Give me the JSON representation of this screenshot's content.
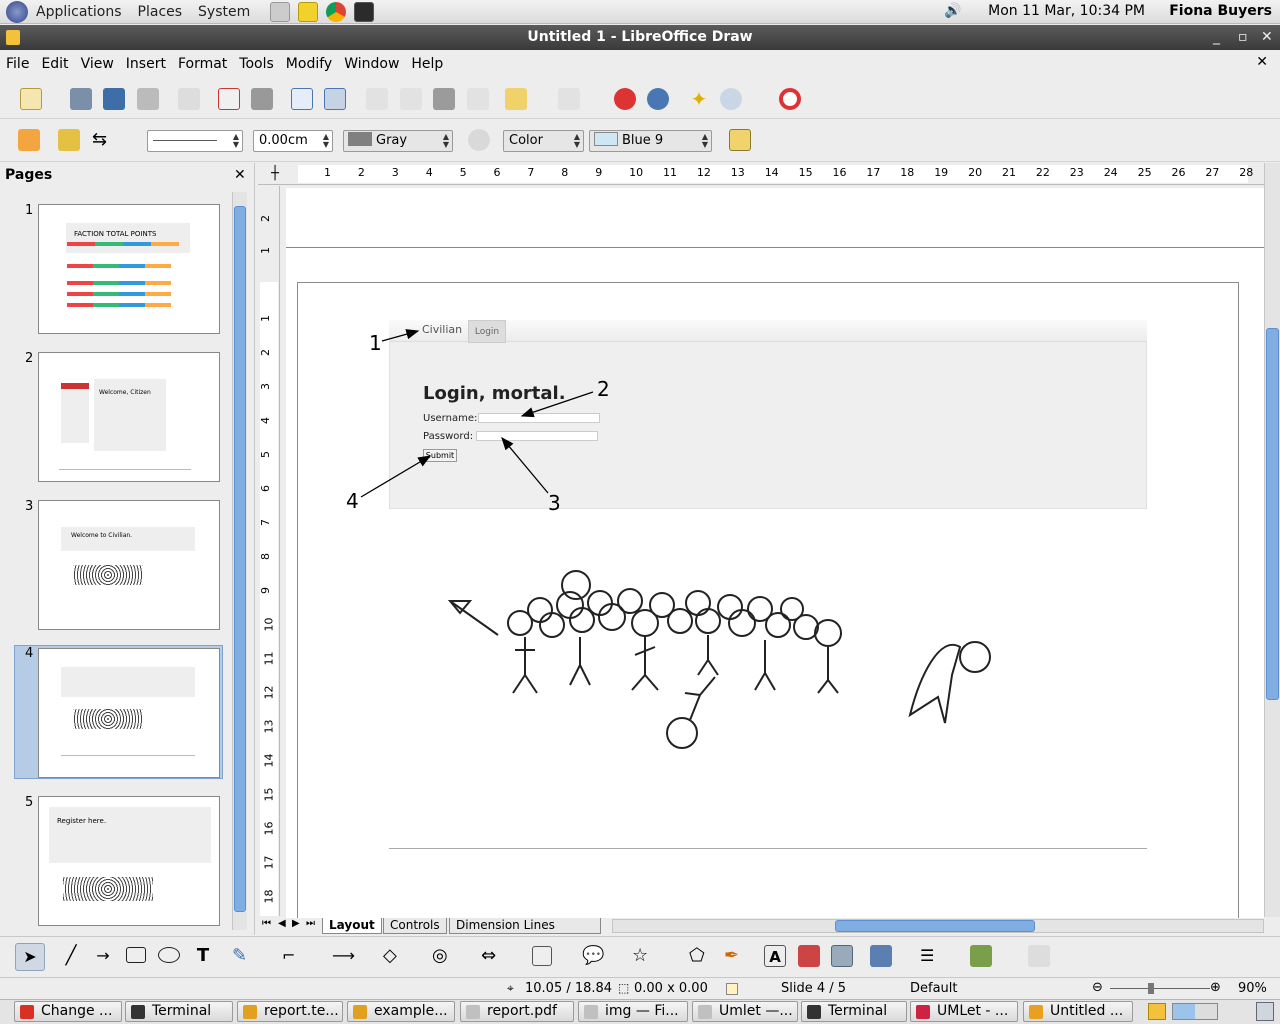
{
  "top_panel": {
    "menus": [
      "Applications",
      "Places",
      "System"
    ],
    "clock": "Mon 11 Mar, 10:34 PM",
    "user": "Fiona Buyers"
  },
  "window": {
    "title": "Untitled 1 - LibreOffice Draw"
  },
  "menubar": [
    "File",
    "Edit",
    "View",
    "Insert",
    "Format",
    "Tools",
    "Modify",
    "Window",
    "Help"
  ],
  "line_toolbar": {
    "line_width": "0.00cm",
    "line_color": "Gray",
    "area_style": "Color",
    "area_color": "Blue 9"
  },
  "pages_panel": {
    "title": "Pages",
    "pages": [
      {
        "num": "1",
        "caption": "FACTION TOTAL POINTS"
      },
      {
        "num": "2",
        "caption": "Welcome, Citizen"
      },
      {
        "num": "3",
        "caption": "Welcome to Civilian."
      },
      {
        "num": "4",
        "caption": ""
      },
      {
        "num": "5",
        "caption": "Register here."
      }
    ],
    "selected": 4
  },
  "ruler": {
    "h": [
      "1",
      "2",
      "3",
      "4",
      "5",
      "6",
      "7",
      "8",
      "9",
      "10",
      "11",
      "12",
      "13",
      "14",
      "15",
      "16",
      "17",
      "18",
      "19",
      "20",
      "21",
      "22",
      "23",
      "24",
      "25",
      "26",
      "27",
      "28"
    ],
    "v": [
      "2",
      "1",
      "1",
      "2",
      "3",
      "4",
      "5",
      "6",
      "7",
      "8",
      "9",
      "10",
      "11",
      "12",
      "13",
      "14",
      "15",
      "16",
      "17",
      "18"
    ]
  },
  "slide": {
    "tab_site": "Civilian",
    "tab_login": "Login",
    "heading": "Login, mortal.",
    "username_label": "Username:",
    "password_label": "Password:",
    "submit_label": "Submit",
    "callouts": [
      "1",
      "2",
      "3",
      "4"
    ]
  },
  "view_tabs": [
    "Layout",
    "Controls",
    "Dimension Lines"
  ],
  "status": {
    "position": "10.05 / 18.84",
    "size": "0.00 x 0.00",
    "slide": "Slide 4 / 5",
    "layout": "Default",
    "zoom": "90%"
  },
  "taskbar": [
    {
      "label": "Change ...",
      "color": "#d93025"
    },
    {
      "label": "Terminal",
      "color": "#333333"
    },
    {
      "label": "report.te...",
      "color": "#e0a020"
    },
    {
      "label": "example...",
      "color": "#e0a020"
    },
    {
      "label": "report.pdf",
      "color": "#c0c0c0"
    },
    {
      "label": "img — Fi...",
      "color": "#c0c0c0"
    },
    {
      "label": "Umlet —...",
      "color": "#c0c0c0"
    },
    {
      "label": "Terminal",
      "color": "#333333"
    },
    {
      "label": "UMLet - ...",
      "color": "#cc2244"
    },
    {
      "label": "Untitled ...",
      "color": "#e8a020"
    }
  ]
}
